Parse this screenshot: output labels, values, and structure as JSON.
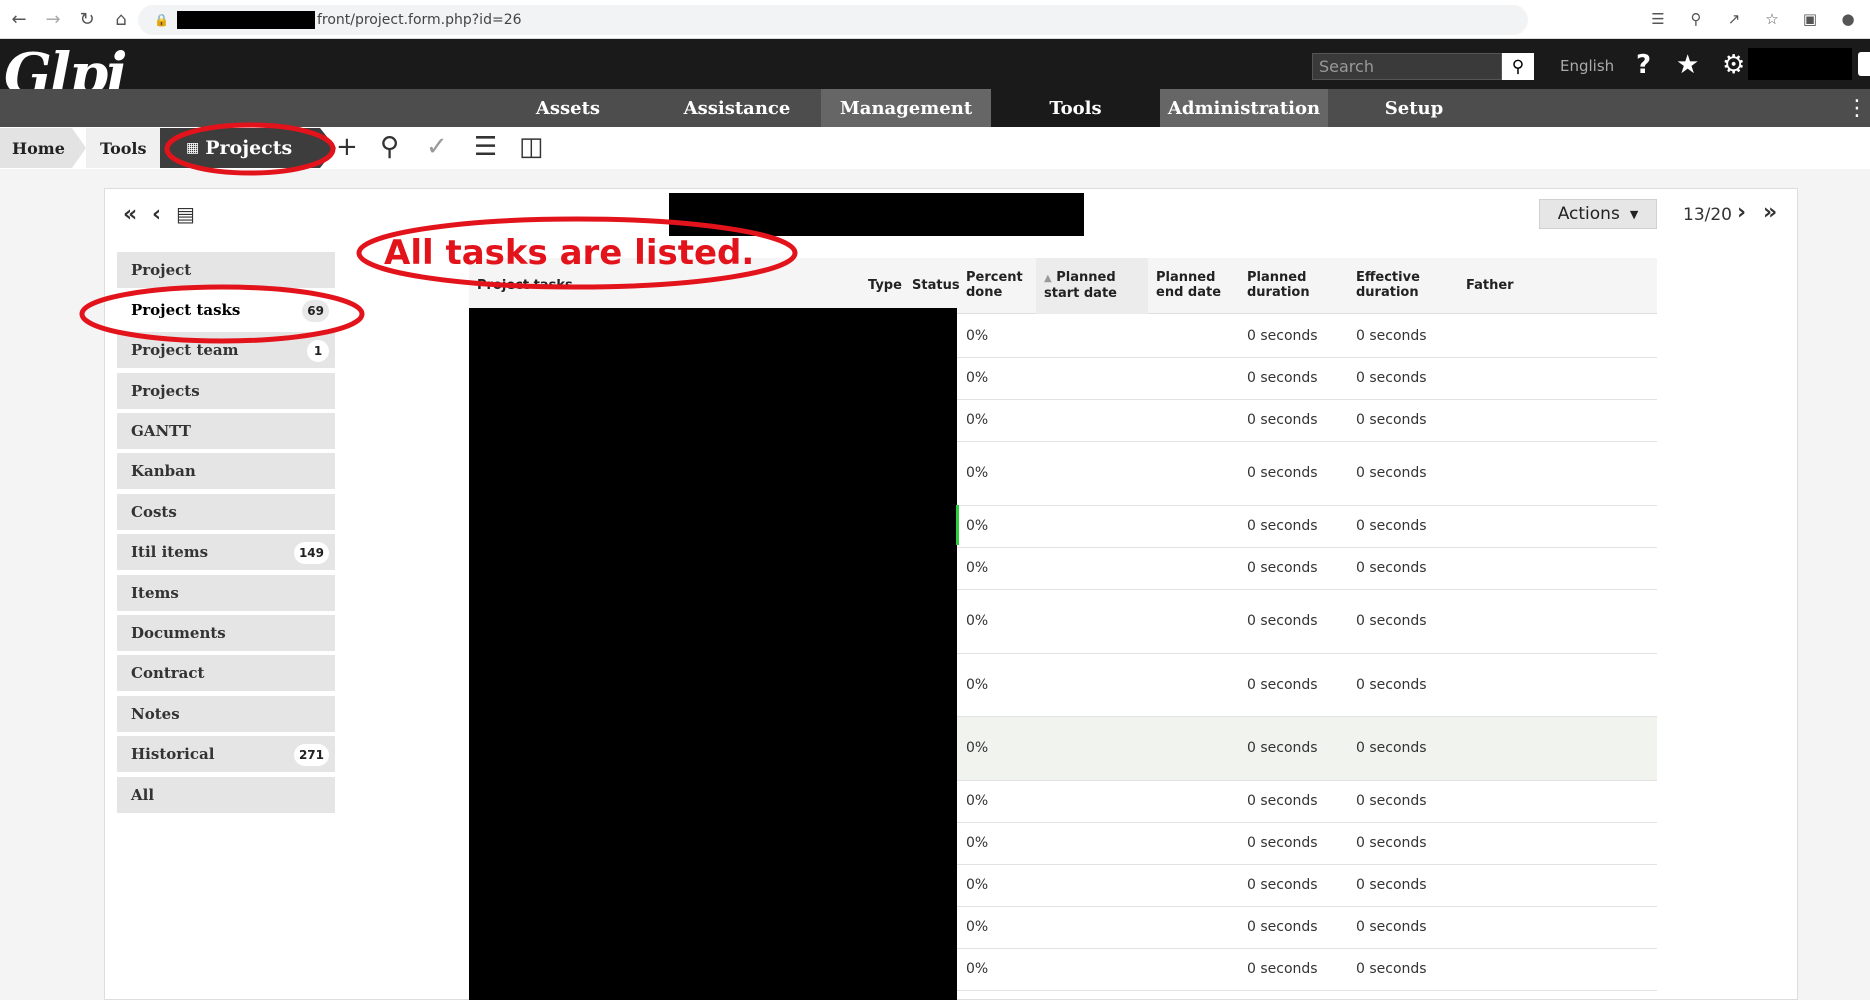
{
  "browser": {
    "url_suffix": "front/project.form.php?id=26"
  },
  "header": {
    "logo": "Glpi",
    "search_placeholder": "Search",
    "language": "English"
  },
  "menu": {
    "items": [
      "Assets",
      "Assistance",
      "Management",
      "Tools",
      "Administration",
      "Setup"
    ]
  },
  "breadcrumb": {
    "home": "Home",
    "tools": "Tools",
    "current": "Projects"
  },
  "record": {
    "actions_label": "Actions",
    "pager": "13/20"
  },
  "annotation": {
    "text": "All tasks are listed."
  },
  "tabs": [
    {
      "label": "Project",
      "badge": ""
    },
    {
      "label": "Project tasks",
      "badge": "69"
    },
    {
      "label": "Project team",
      "badge": "1"
    },
    {
      "label": "Projects",
      "badge": ""
    },
    {
      "label": "GANTT",
      "badge": ""
    },
    {
      "label": "Kanban",
      "badge": ""
    },
    {
      "label": "Costs",
      "badge": ""
    },
    {
      "label": "Itil items",
      "badge": "149"
    },
    {
      "label": "Items",
      "badge": ""
    },
    {
      "label": "Documents",
      "badge": ""
    },
    {
      "label": "Contract",
      "badge": ""
    },
    {
      "label": "Notes",
      "badge": ""
    },
    {
      "label": "Historical",
      "badge": "271"
    },
    {
      "label": "All",
      "badge": ""
    }
  ],
  "table": {
    "columns": {
      "name": "Project tasks",
      "type": "Type",
      "status": "Status",
      "percent_1": "Percent",
      "percent_2": "done",
      "pstart_1": "Planned",
      "pstart_2": "start date",
      "pend_1": "Planned",
      "pend_2": "end date",
      "pdur_1": "Planned",
      "pdur_2": "duration",
      "edur_1": "Effective",
      "edur_2": "duration",
      "father": "Father"
    },
    "rows": [
      {
        "percent": "0%",
        "planned_duration": "0 seconds",
        "effective_duration": "0 seconds"
      },
      {
        "percent": "0%",
        "planned_duration": "0 seconds",
        "effective_duration": "0 seconds"
      },
      {
        "percent": "0%",
        "planned_duration": "0 seconds",
        "effective_duration": "0 seconds"
      },
      {
        "percent": "0%",
        "planned_duration": "0 seconds",
        "effective_duration": "0 seconds"
      },
      {
        "percent": "0%",
        "planned_duration": "0 seconds",
        "effective_duration": "0 seconds"
      },
      {
        "percent": "0%",
        "planned_duration": "0 seconds",
        "effective_duration": "0 seconds"
      },
      {
        "percent": "0%",
        "planned_duration": "0 seconds",
        "effective_duration": "0 seconds"
      },
      {
        "percent": "0%",
        "planned_duration": "0 seconds",
        "effective_duration": "0 seconds"
      },
      {
        "percent": "0%",
        "planned_duration": "0 seconds",
        "effective_duration": "0 seconds"
      },
      {
        "percent": "0%",
        "planned_duration": "0 seconds",
        "effective_duration": "0 seconds"
      },
      {
        "percent": "0%",
        "planned_duration": "0 seconds",
        "effective_duration": "0 seconds"
      },
      {
        "percent": "0%",
        "planned_duration": "0 seconds",
        "effective_duration": "0 seconds"
      },
      {
        "percent": "0%",
        "planned_duration": "0 seconds",
        "effective_duration": "0 seconds"
      },
      {
        "percent": "0%",
        "planned_duration": "0 seconds",
        "effective_duration": "0 seconds"
      }
    ]
  },
  "colors": {
    "annotation_red": "#e3131c",
    "header_dark": "#1a1a1a",
    "menu_gray": "#4d4d4d"
  }
}
